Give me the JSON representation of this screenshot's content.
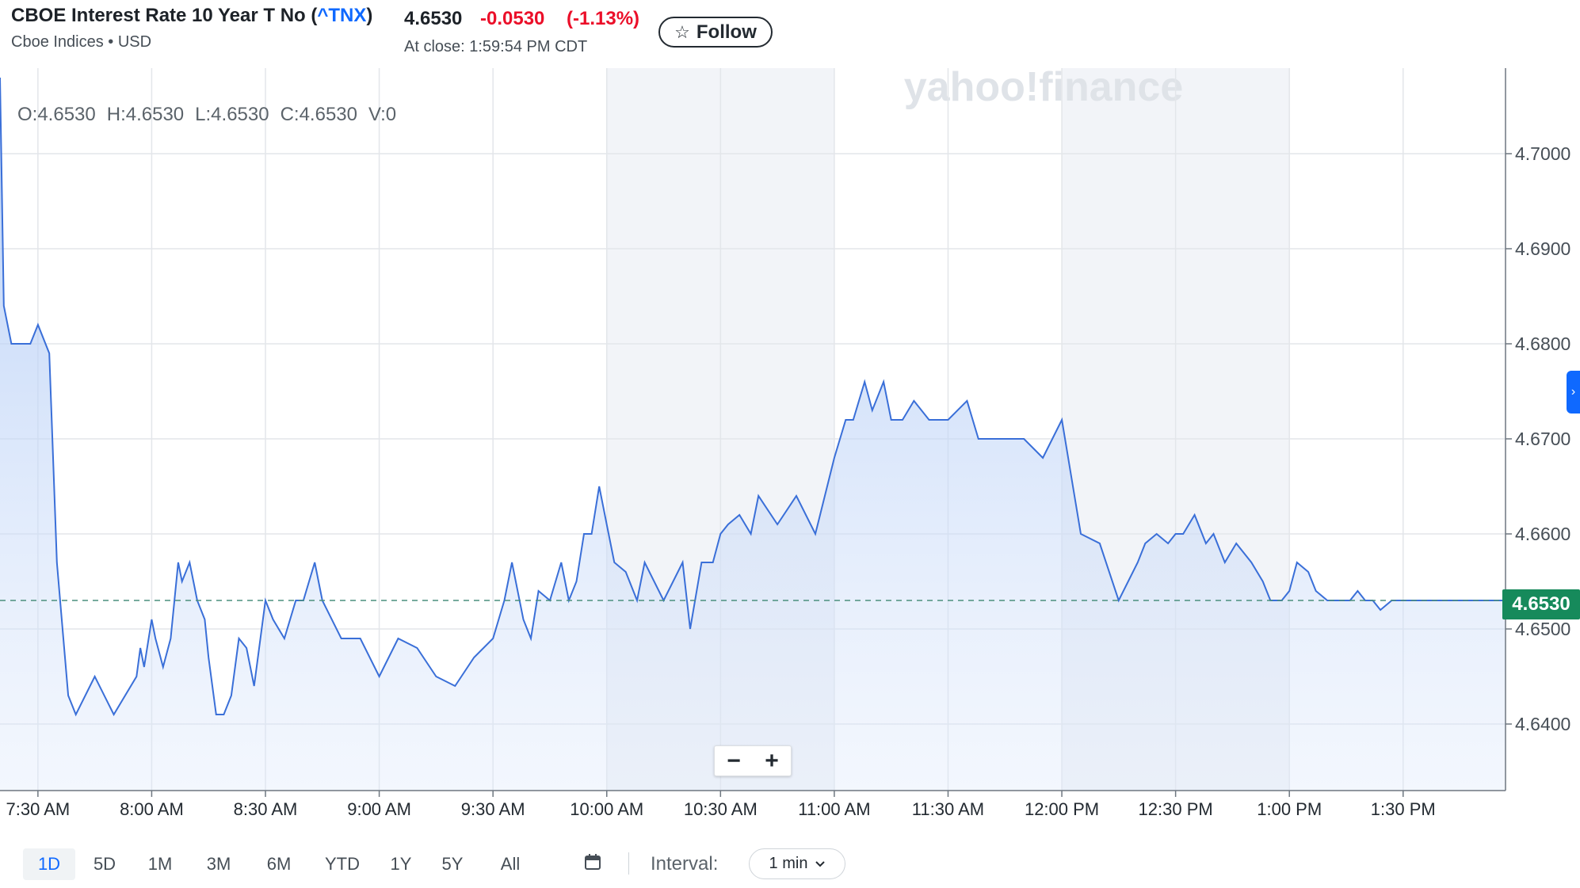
{
  "header": {
    "name": "CBOE Interest Rate 10 Year T No (",
    "symbol": "^TNX",
    "name_end": ")",
    "exchange": "Cboe Indices • USD",
    "price": "4.6530",
    "change": "-0.0530",
    "change_pct": "(-1.13%)",
    "close_time": "At close: 1:59:54 PM CDT",
    "follow_label": "Follow"
  },
  "ohlc": {
    "open": "O:4.6530",
    "high": "H:4.6530",
    "low": "L:4.6530",
    "close": "C:4.6530",
    "volume": "V:0"
  },
  "zoom": {
    "out": "−",
    "in": "+"
  },
  "last_price_tag": "4.6530",
  "side_tab_icon": "›",
  "colors": {
    "line": "#3a6fd8",
    "last_tag": "#168a5b",
    "negative": "#eb0f29",
    "symbol": "#0f69ff",
    "shade": "#f2f4f8"
  },
  "footer": {
    "ranges": [
      "1D",
      "5D",
      "1M",
      "3M",
      "6M",
      "YTD",
      "1Y",
      "5Y",
      "All"
    ],
    "active_range": "1D",
    "interval_label": "Interval:",
    "interval_value": "1 min"
  },
  "chart_data": {
    "type": "area",
    "watermark": "yahoo!finance",
    "x_ticks": [
      "7:30 AM",
      "8:00 AM",
      "8:30 AM",
      "9:00 AM",
      "9:30 AM",
      "10:00 AM",
      "10:30 AM",
      "11:00 AM",
      "11:30 AM",
      "12:00 PM",
      "12:30 PM",
      "1:00 PM",
      "1:30 PM"
    ],
    "y_ticks": [
      "4.6400",
      "4.6500",
      "4.6600",
      "4.6700",
      "4.6800",
      "4.6900",
      "4.7000"
    ],
    "ylim": [
      4.633,
      4.709
    ],
    "x_unit": "minutes from 7:20 AM",
    "xlim": [
      0,
      397
    ],
    "shaded_ranges": [
      [
        160,
        220
      ],
      [
        280,
        340
      ]
    ],
    "reference_line": 4.653,
    "x": [
      0,
      1,
      3,
      8,
      10,
      13,
      15,
      18,
      20,
      25,
      30,
      36,
      37,
      38,
      40,
      41,
      43,
      45,
      47,
      48,
      50,
      52,
      54,
      55,
      57,
      59,
      61,
      63,
      65,
      67,
      70,
      72,
      75,
      78,
      80,
      83,
      85,
      90,
      95,
      100,
      105,
      110,
      115,
      120,
      125,
      130,
      133,
      135,
      138,
      140,
      142,
      145,
      148,
      150,
      152,
      154,
      156,
      158,
      160,
      162,
      165,
      168,
      170,
      175,
      180,
      182,
      185,
      188,
      190,
      192,
      195,
      198,
      200,
      205,
      210,
      215,
      220,
      223,
      225,
      228,
      230,
      233,
      235,
      238,
      241,
      245,
      250,
      255,
      258,
      262,
      265,
      270,
      275,
      280,
      285,
      290,
      295,
      300,
      302,
      305,
      308,
      310,
      312,
      315,
      318,
      320,
      323,
      326,
      330,
      333,
      335,
      338,
      340,
      342,
      345,
      347,
      350,
      353,
      356,
      358,
      360,
      362,
      364,
      367,
      370,
      373,
      375,
      378,
      380,
      383,
      385,
      388,
      390,
      393,
      395,
      397
    ],
    "y": [
      4.708,
      4.684,
      4.68,
      4.68,
      4.682,
      4.679,
      4.657,
      4.643,
      4.641,
      4.645,
      4.641,
      4.645,
      4.648,
      4.646,
      4.651,
      4.649,
      4.646,
      4.649,
      4.657,
      4.655,
      4.657,
      4.653,
      4.651,
      4.647,
      4.641,
      4.641,
      4.643,
      4.649,
      4.648,
      4.644,
      4.653,
      4.651,
      4.649,
      4.653,
      4.653,
      4.657,
      4.653,
      4.649,
      4.649,
      4.645,
      4.649,
      4.648,
      4.645,
      4.644,
      4.647,
      4.649,
      4.653,
      4.657,
      4.651,
      4.649,
      4.654,
      4.653,
      4.657,
      4.653,
      4.655,
      4.66,
      4.66,
      4.665,
      4.661,
      4.657,
      4.656,
      4.653,
      4.657,
      4.653,
      4.657,
      4.65,
      4.657,
      4.657,
      4.66,
      4.661,
      4.662,
      4.66,
      4.664,
      4.661,
      4.664,
      4.66,
      4.668,
      4.672,
      4.672,
      4.676,
      4.673,
      4.676,
      4.672,
      4.672,
      4.674,
      4.672,
      4.672,
      4.674,
      4.67,
      4.67,
      4.67,
      4.67,
      4.668,
      4.672,
      4.66,
      4.659,
      4.653,
      4.657,
      4.659,
      4.66,
      4.659,
      4.66,
      4.66,
      4.662,
      4.659,
      4.66,
      4.657,
      4.659,
      4.657,
      4.655,
      4.653,
      4.653,
      4.654,
      4.657,
      4.656,
      4.654,
      4.653,
      4.653,
      4.653,
      4.654,
      4.653,
      4.653,
      4.652,
      4.653,
      4.653,
      4.653,
      4.653,
      4.653,
      4.653,
      4.653,
      4.653,
      4.653,
      4.653,
      4.653,
      4.653,
      4.653
    ]
  }
}
